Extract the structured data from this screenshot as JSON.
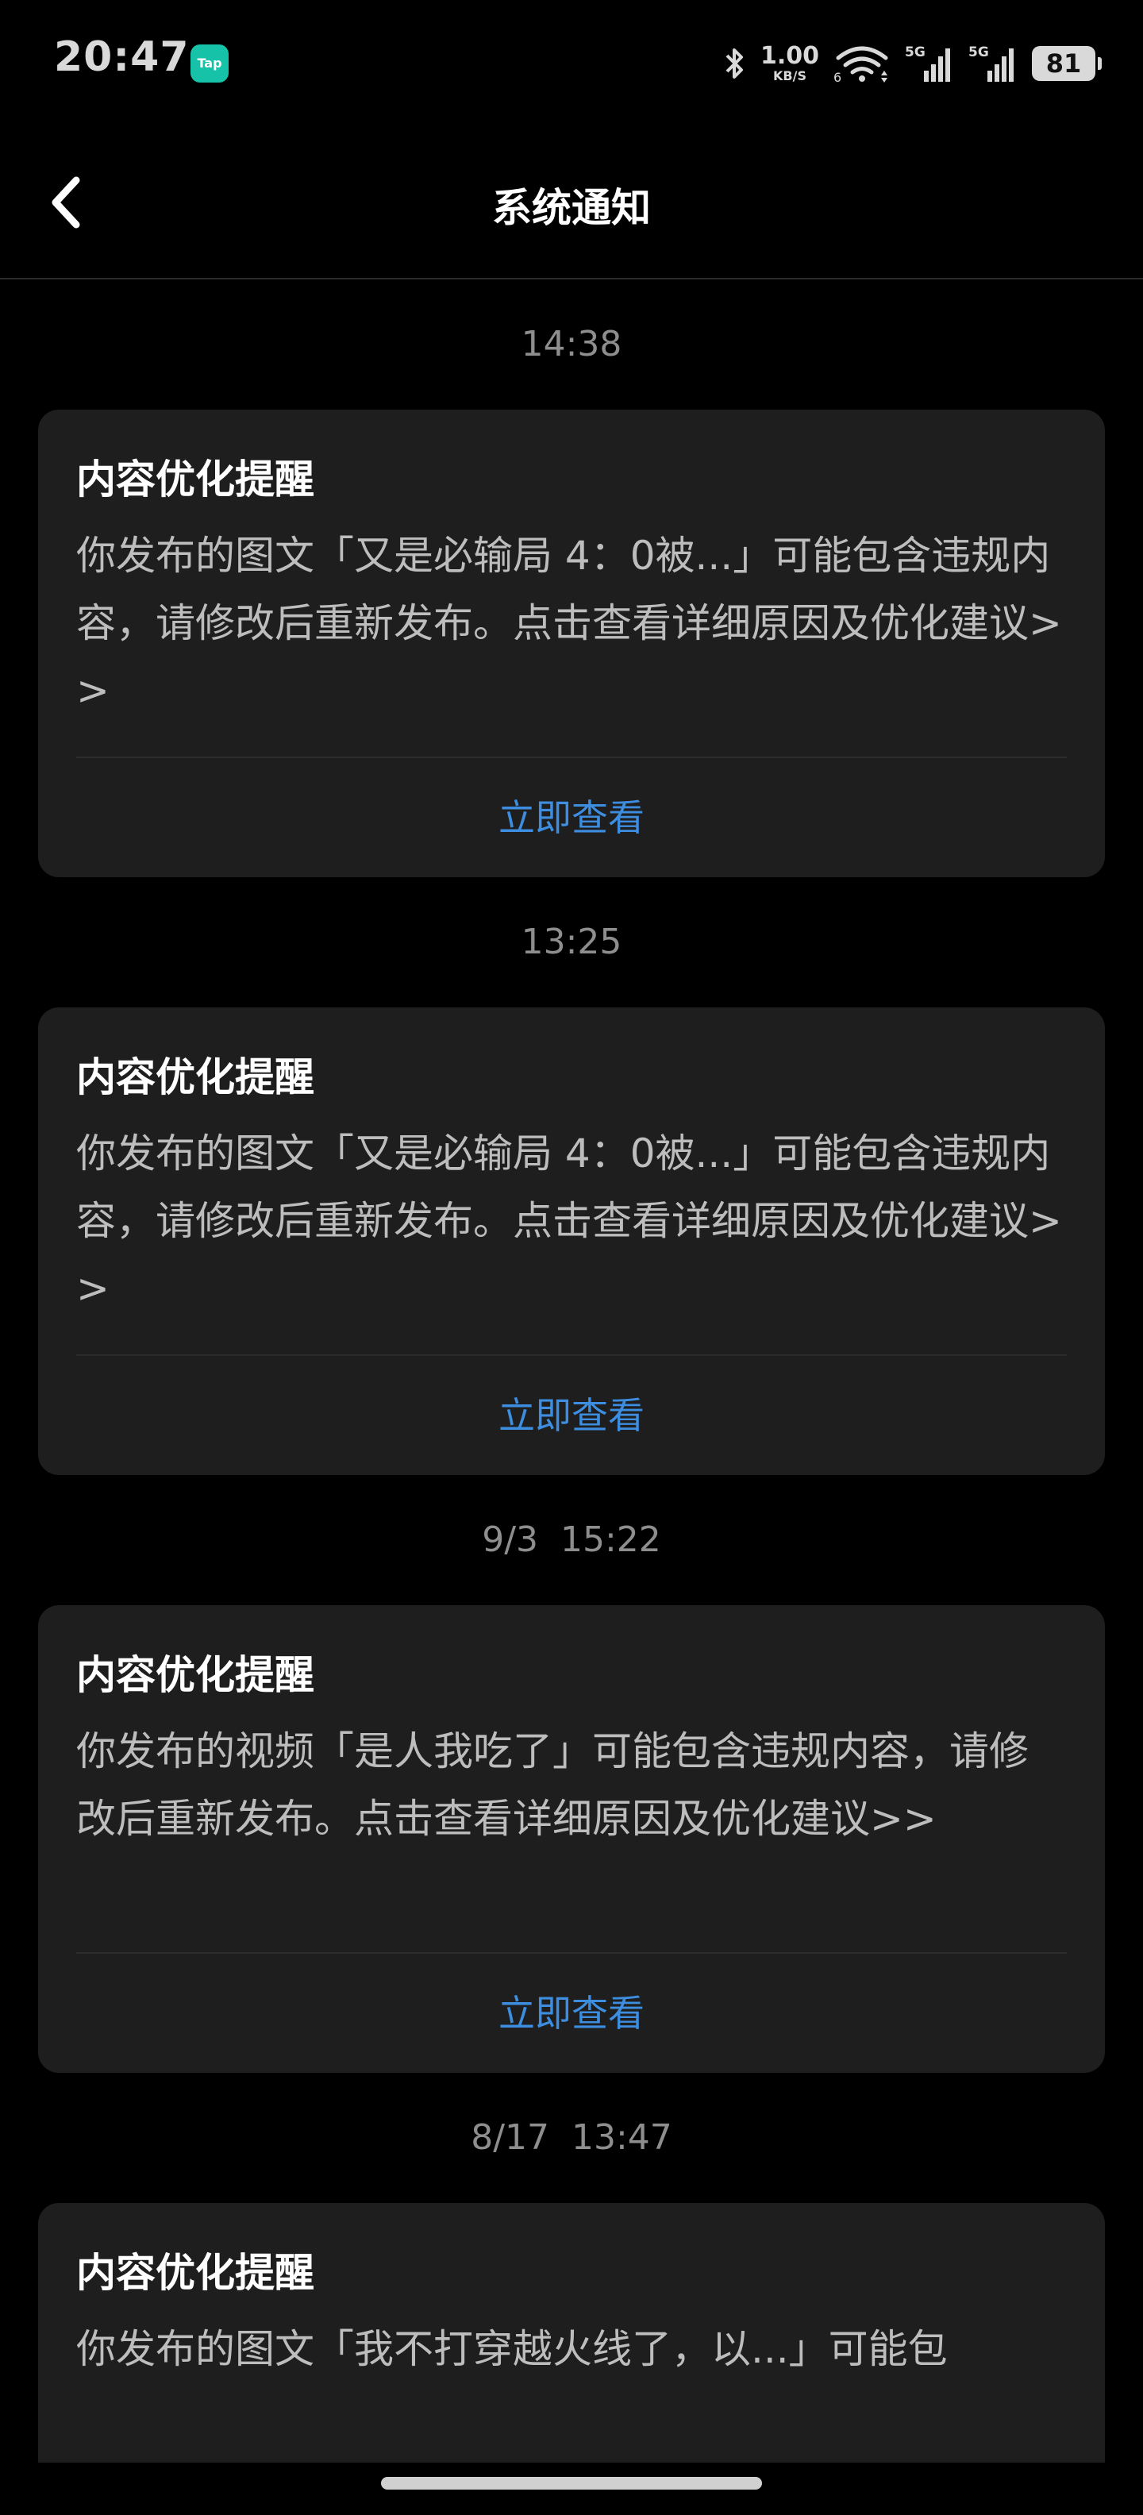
{
  "status_bar": {
    "time": "20:47",
    "app_badge": "Tap",
    "net_speed_value": "1.00",
    "net_speed_unit": "KB/S",
    "wifi_label": "6",
    "signal_1_label": "5G",
    "signal_2_label": "5G",
    "battery": "81"
  },
  "header": {
    "title": "系统通知"
  },
  "notifications": [
    {
      "time": "14:38",
      "title": "内容优化提醒",
      "body": "你发布的图文「又是必输局 4：0被...」可能包含违规内容，请修改后重新发布。点击查看详细原因及优化建议>>",
      "action": "立即查看"
    },
    {
      "time": "13:25",
      "title": "内容优化提醒",
      "body": "你发布的图文「又是必输局 4：0被...」可能包含违规内容，请修改后重新发布。点击查看详细原因及优化建议>>",
      "action": "立即查看"
    },
    {
      "time": "9/3  15:22",
      "title": "内容优化提醒",
      "body": "你发布的视频「是人我吃了」可能包含违规内容，请修改后重新发布。点击查看详细原因及优化建议>>",
      "action": "立即查看"
    },
    {
      "time": "8/17  13:47",
      "title": "内容优化提醒",
      "body": "你发布的图文「我不打穿越火线了，以...」可能包",
      "action": ""
    }
  ]
}
